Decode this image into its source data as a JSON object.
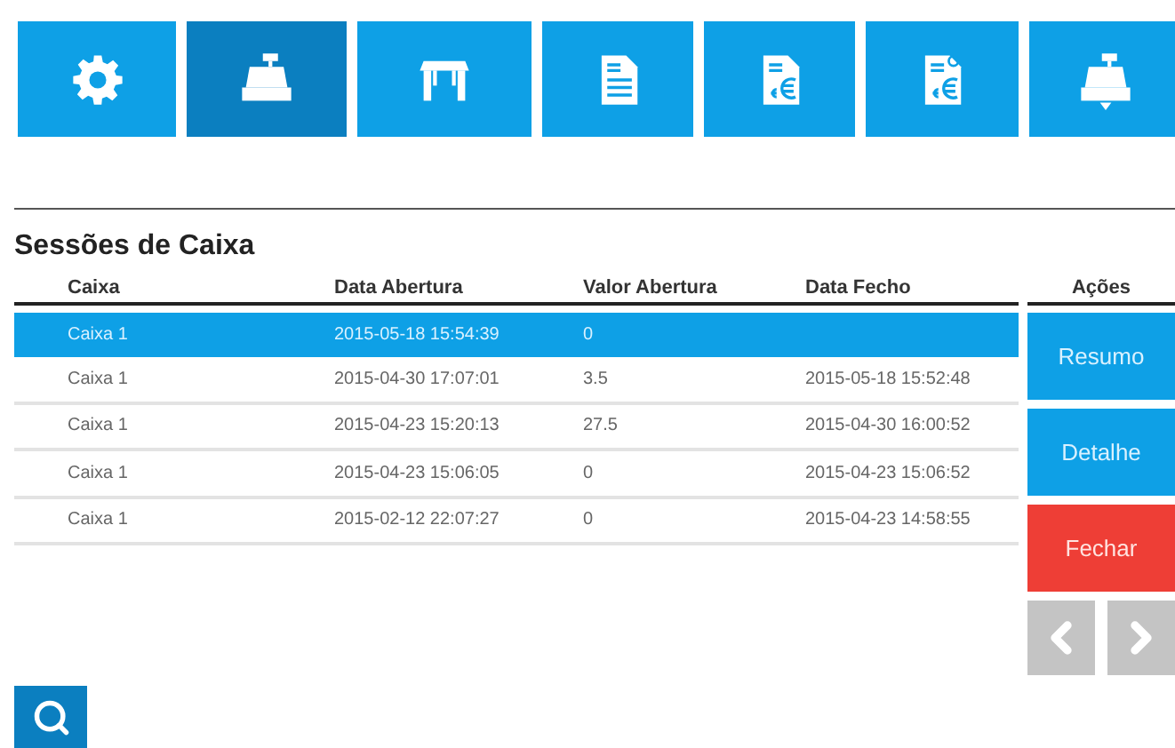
{
  "toolbar": [
    {
      "kind": "settings",
      "selected": false
    },
    {
      "kind": "register",
      "selected": true
    },
    {
      "kind": "table",
      "selected": false
    },
    {
      "kind": "document",
      "selected": false
    },
    {
      "kind": "invoice",
      "selected": false
    },
    {
      "kind": "refund",
      "selected": false
    },
    {
      "kind": "register-out",
      "selected": false
    }
  ],
  "title": "Sessões de Caixa",
  "table": {
    "columns": [
      "Caixa",
      "Data Abertura",
      "Valor Abertura",
      "Data Fecho",
      "Ações"
    ],
    "rows": [
      {
        "cells": [
          "Caixa 1",
          "2015-05-18 15:54:39",
          "0",
          ""
        ],
        "selected": true
      },
      {
        "cells": [
          "Caixa 1",
          "2015-04-30 17:07:01",
          "3.5",
          "2015-05-18 15:52:48"
        ],
        "selected": false
      },
      {
        "cells": [
          "Caixa 1",
          "2015-04-23 15:20:13",
          "27.5",
          "2015-04-30 16:00:52"
        ],
        "selected": false
      },
      {
        "cells": [
          "Caixa 1",
          "2015-04-23 15:06:05",
          "0",
          "2015-04-23 15:06:52"
        ],
        "selected": false
      },
      {
        "cells": [
          "Caixa 1",
          "2015-02-12 22:07:27",
          "0",
          "2015-04-23 14:58:55"
        ],
        "selected": false
      }
    ]
  },
  "actions": [
    {
      "label": "Resumo",
      "kind": "primary"
    },
    {
      "label": "Detalhe",
      "kind": "primary"
    },
    {
      "label": "Fechar",
      "kind": "danger"
    }
  ]
}
